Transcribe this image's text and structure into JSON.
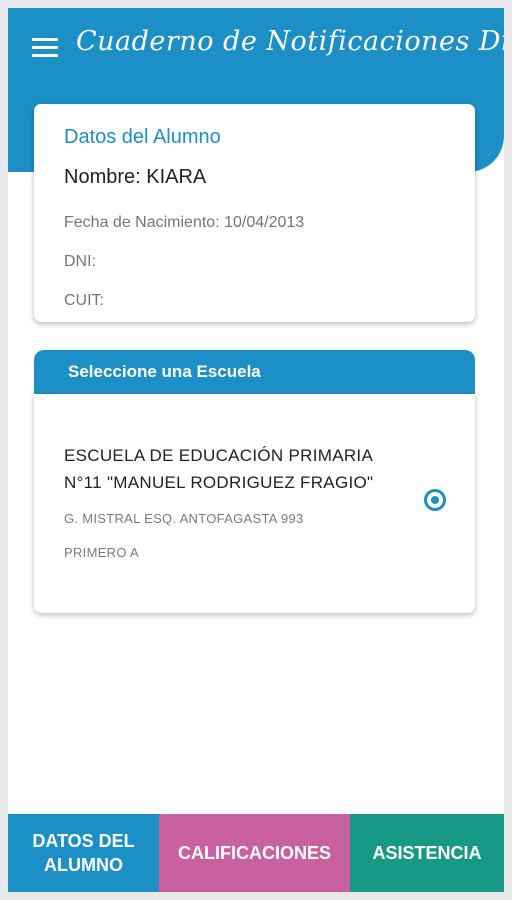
{
  "app": {
    "title": "Cuaderno de Notificaciones Digital",
    "menu_icon": "hamburger-menu-icon",
    "colors": {
      "primary": "#1d8fc7",
      "pink": "#c9609f",
      "teal": "#169a86"
    }
  },
  "student": {
    "section_title": "Datos del Alumno",
    "name_line": "Nombre: KIARA",
    "birth_line": "Fecha de Nacimiento: 10/04/2013",
    "dni_line": "DNI:",
    "cuit_line": "CUIT:"
  },
  "school_select": {
    "header": "Seleccione una Escuela",
    "school": {
      "name": "ESCUELA DE EDUCACIÓN PRIMARIA N°11 \"MANUEL RODRIGUEZ FRAGIO\"",
      "address": "G. MISTRAL ESQ. ANTOFAGASTA 993",
      "grade": "PRIMERO A",
      "selected": true
    }
  },
  "bottom_nav": {
    "items": [
      {
        "label_line1": "DATOS DEL",
        "label_line2": "ALUMNO"
      },
      {
        "label": "CALIFICACIONES"
      },
      {
        "label": "ASISTENCIA"
      }
    ]
  }
}
